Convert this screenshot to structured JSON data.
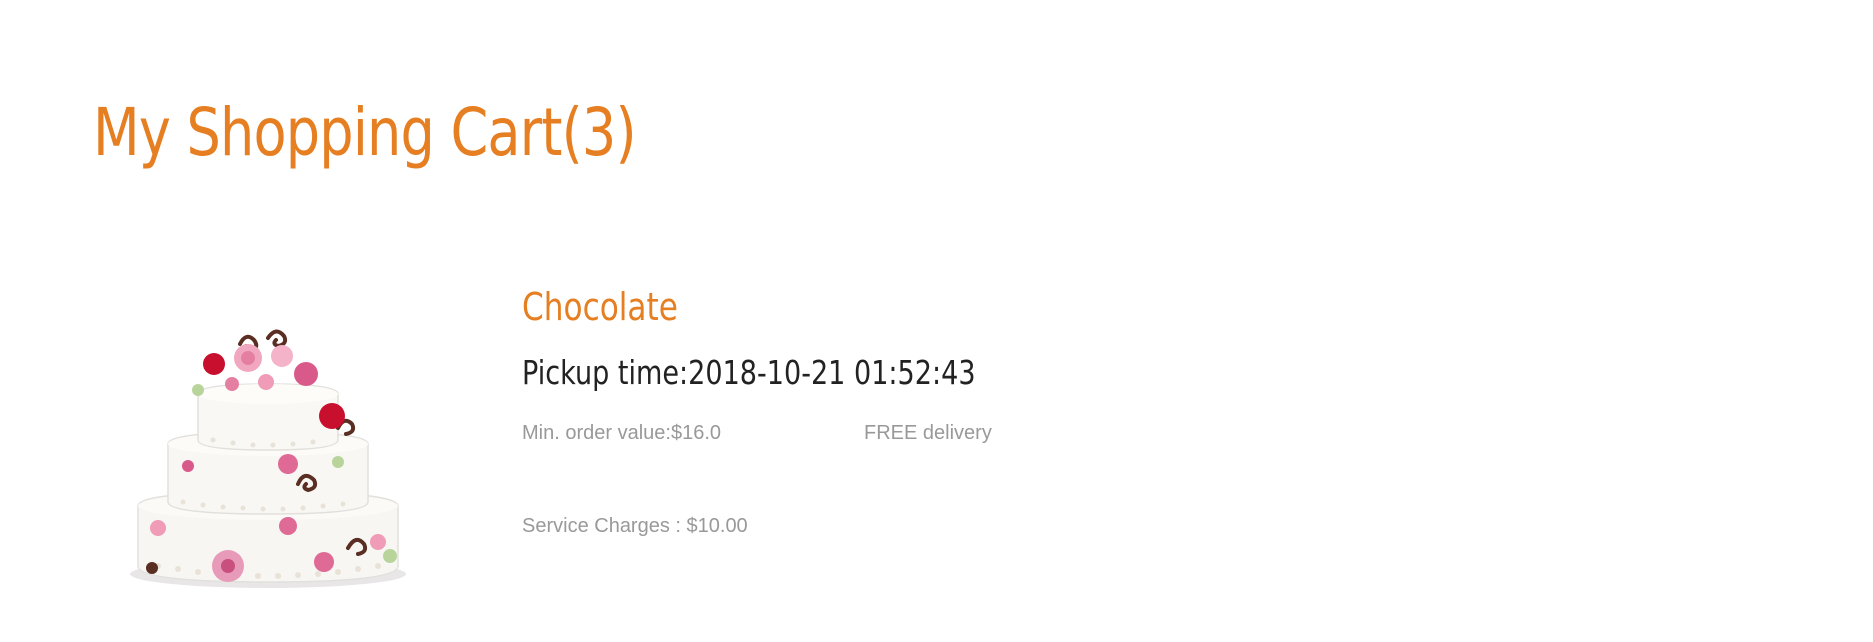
{
  "cart": {
    "title": "My Shopping Cart(3)"
  },
  "item": {
    "name": "Chocolate",
    "pickup_label": "Pickup time:",
    "pickup_value": "2018-10-21 01:52:43",
    "min_order": "Min. order value:$16.0",
    "delivery": "FREE delivery",
    "service_charges": "Service Charges : $10.00",
    "image_icon": "wedding-cake-image"
  },
  "colors": {
    "accent": "#e67e22",
    "text_dark": "#222222",
    "text_muted": "#999999"
  }
}
